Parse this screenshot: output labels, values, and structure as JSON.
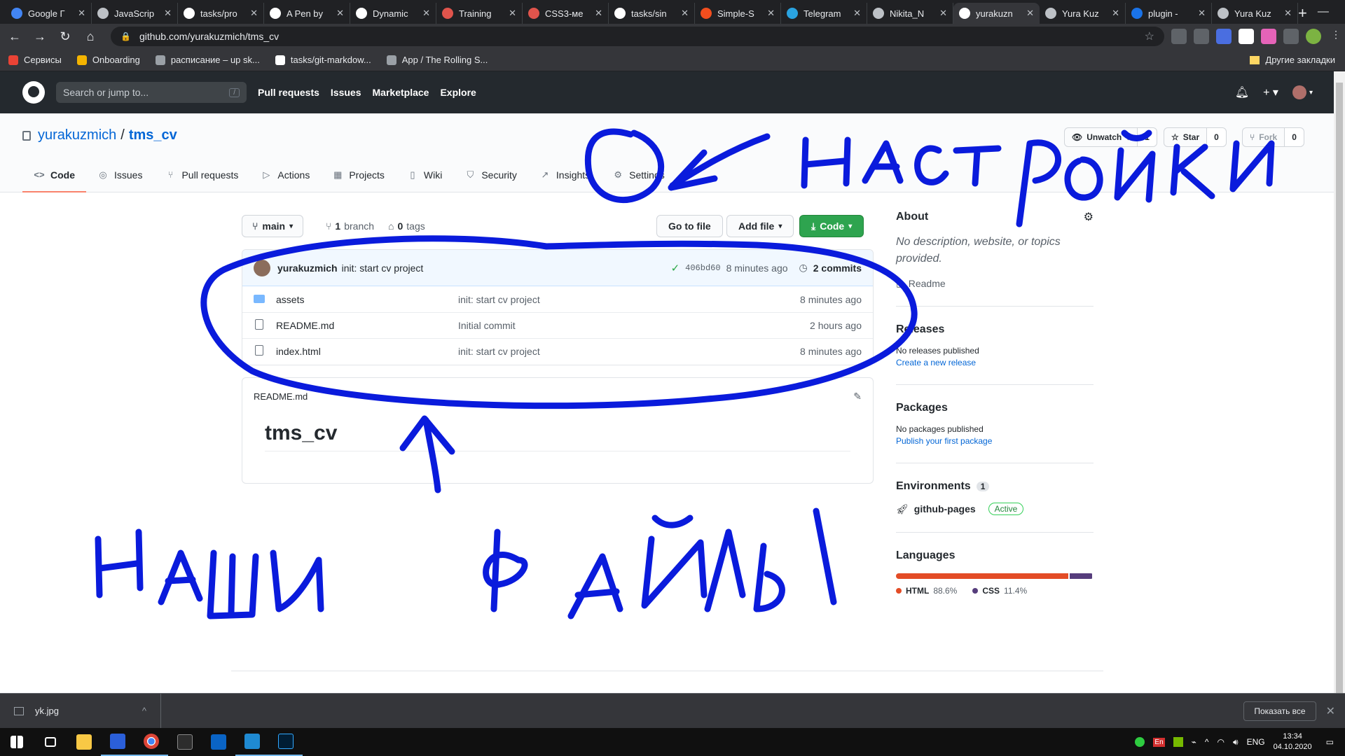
{
  "browser": {
    "tabs": [
      {
        "title": "Google Г",
        "color": "#4285f4"
      },
      {
        "title": "JavaScrip",
        "color": "#bdc1c6"
      },
      {
        "title": "tasks/pro",
        "color": "#ffffff"
      },
      {
        "title": "A Pen by",
        "color": "#ffffff"
      },
      {
        "title": "Dynamic",
        "color": "#ffffff"
      },
      {
        "title": "Training",
        "color": "#e0544c"
      },
      {
        "title": "CSS3-ме",
        "color": "#e0544c"
      },
      {
        "title": "tasks/sin",
        "color": "#ffffff"
      },
      {
        "title": "Simple-S",
        "color": "#f24e1e"
      },
      {
        "title": "Telegram",
        "color": "#2aa3e0"
      },
      {
        "title": "Nikita_N",
        "color": "#bdc1c6"
      },
      {
        "title": "yurakuzn",
        "color": "#ffffff",
        "active": true
      },
      {
        "title": "Yura Kuz",
        "color": "#bdc1c6"
      },
      {
        "title": "plugin -",
        "color": "#1a73e8"
      },
      {
        "title": "Yura Kuz",
        "color": "#bdc1c6"
      }
    ],
    "url": "github.com/yurakuzmich/tms_cv",
    "bookmarks": [
      {
        "label": "Сервисы",
        "color": "#ea4335"
      },
      {
        "label": "Onboarding",
        "color": "#f4b400"
      },
      {
        "label": "расписание – up sk...",
        "color": "#9aa0a6"
      },
      {
        "label": "tasks/git-markdow...",
        "color": "#ffffff"
      },
      {
        "label": "App / The Rolling S...",
        "color": "#9aa0a6"
      }
    ],
    "other_bookmarks": "Другие закладки"
  },
  "github": {
    "search_placeholder": "Search or jump to...",
    "search_key": "/",
    "nav": [
      "Pull requests",
      "Issues",
      "Marketplace",
      "Explore"
    ],
    "owner": "yurakuzmich",
    "repo": "tms_cv",
    "watch": {
      "label": "Unwatch",
      "count": "1"
    },
    "star": {
      "label": "Star",
      "count": "0"
    },
    "fork": {
      "label": "Fork",
      "count": "0"
    },
    "tabs": [
      {
        "label": "Code",
        "icon": "<>",
        "active": true
      },
      {
        "label": "Issues",
        "icon": "◎"
      },
      {
        "label": "Pull requests",
        "icon": "⑂"
      },
      {
        "label": "Actions",
        "icon": "▷"
      },
      {
        "label": "Projects",
        "icon": "▦"
      },
      {
        "label": "Wiki",
        "icon": "▯"
      },
      {
        "label": "Security",
        "icon": "⛉"
      },
      {
        "label": "Insights",
        "icon": "↗"
      },
      {
        "label": "Settings",
        "icon": "⚙"
      }
    ],
    "branch": "main",
    "branch_count": "1",
    "branch_label": "branch",
    "tag_count": "0",
    "tag_label": "tags",
    "go_to_file": "Go to file",
    "add_file": "Add file",
    "code_button": "Code",
    "latest_commit": {
      "author": "yurakuzmich",
      "message": "init: start cv project",
      "sha": "406bd60",
      "time": "8 minutes ago",
      "commits": "2 commits"
    },
    "files": [
      {
        "type": "folder",
        "name": "assets",
        "message": "init: start cv project",
        "age": "8 minutes ago"
      },
      {
        "type": "file",
        "name": "README.md",
        "message": "Initial commit",
        "age": "2 hours ago"
      },
      {
        "type": "file",
        "name": "index.html",
        "message": "init: start cv project",
        "age": "8 minutes ago"
      }
    ],
    "readme_label": "README.md",
    "readme_title": "tms_cv",
    "sidebar": {
      "about_title": "About",
      "about_desc": "No description, website, or topics provided.",
      "readme_link": "Readme",
      "releases_title": "Releases",
      "releases_none": "No releases published",
      "releases_link": "Create a new release",
      "packages_title": "Packages",
      "packages_none": "No packages published",
      "packages_link": "Publish your first package",
      "env_title": "Environments",
      "env_count": "1",
      "env_name": "github-pages",
      "env_status": "Active",
      "lang_title": "Languages",
      "languages": [
        {
          "name": "HTML",
          "pct": "88.6%",
          "value": 88.6,
          "color": "#e34c26"
        },
        {
          "name": "CSS",
          "pct": "11.4%",
          "value": 11.4,
          "color": "#563d7c"
        }
      ]
    }
  },
  "downloads": {
    "file": "yk.jpg",
    "show_all": "Показать все"
  },
  "taskbar": {
    "lang": "ENG",
    "time": "13:34",
    "date": "04.10.2020"
  },
  "annotations": {
    "top_text": "настройки",
    "bottom_text": "НАШИ ФАЙЛЫ"
  }
}
